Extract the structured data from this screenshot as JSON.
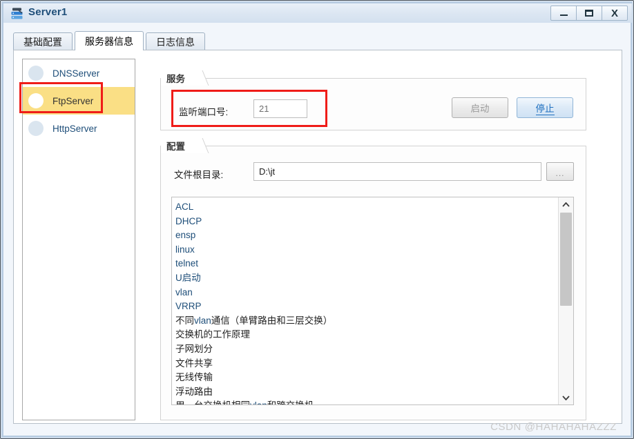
{
  "window": {
    "title": "Server1",
    "icon": "server-device-icon",
    "controls": {
      "minimize": "minimize-icon",
      "maximize": "maximize-icon",
      "close": "X"
    }
  },
  "tabs": [
    {
      "label": "基础配置",
      "active": false
    },
    {
      "label": "服务器信息",
      "active": true
    },
    {
      "label": "日志信息",
      "active": false
    }
  ],
  "sidebar": {
    "items": [
      {
        "label": "DNSServer",
        "selected": false
      },
      {
        "label": "FtpServer",
        "selected": true
      },
      {
        "label": "HttpServer",
        "selected": false
      }
    ]
  },
  "service_group": {
    "title": "服务",
    "port_label": "监听端口号:",
    "port_value": "21",
    "port_placeholder": "21",
    "start_button": "启动",
    "stop_button": "停止"
  },
  "config_group": {
    "title": "配置",
    "root_label": "文件根目录:",
    "root_value": "D:\\jt",
    "root_placeholder": "",
    "browse_button": "...",
    "files": [
      "ACL",
      "DHCP",
      "ensp",
      "linux",
      "telnet",
      "U启动",
      "vlan",
      "VRRP",
      "不同vlan通信（单臂路由和三层交换）",
      "交换机的工作原理",
      "子网划分",
      "文件共享",
      "无线传输",
      "浮动路由",
      "用一台交换机相同vlan和跨交换机"
    ],
    "scrollbar": {
      "up_arrow": "▲",
      "down_arrow": "▼"
    }
  },
  "annotations": {
    "highlight_color": "#ef1c18",
    "selection_color": "#fadf85"
  },
  "watermark": "CSDN @HAHAHAHAZZZ"
}
